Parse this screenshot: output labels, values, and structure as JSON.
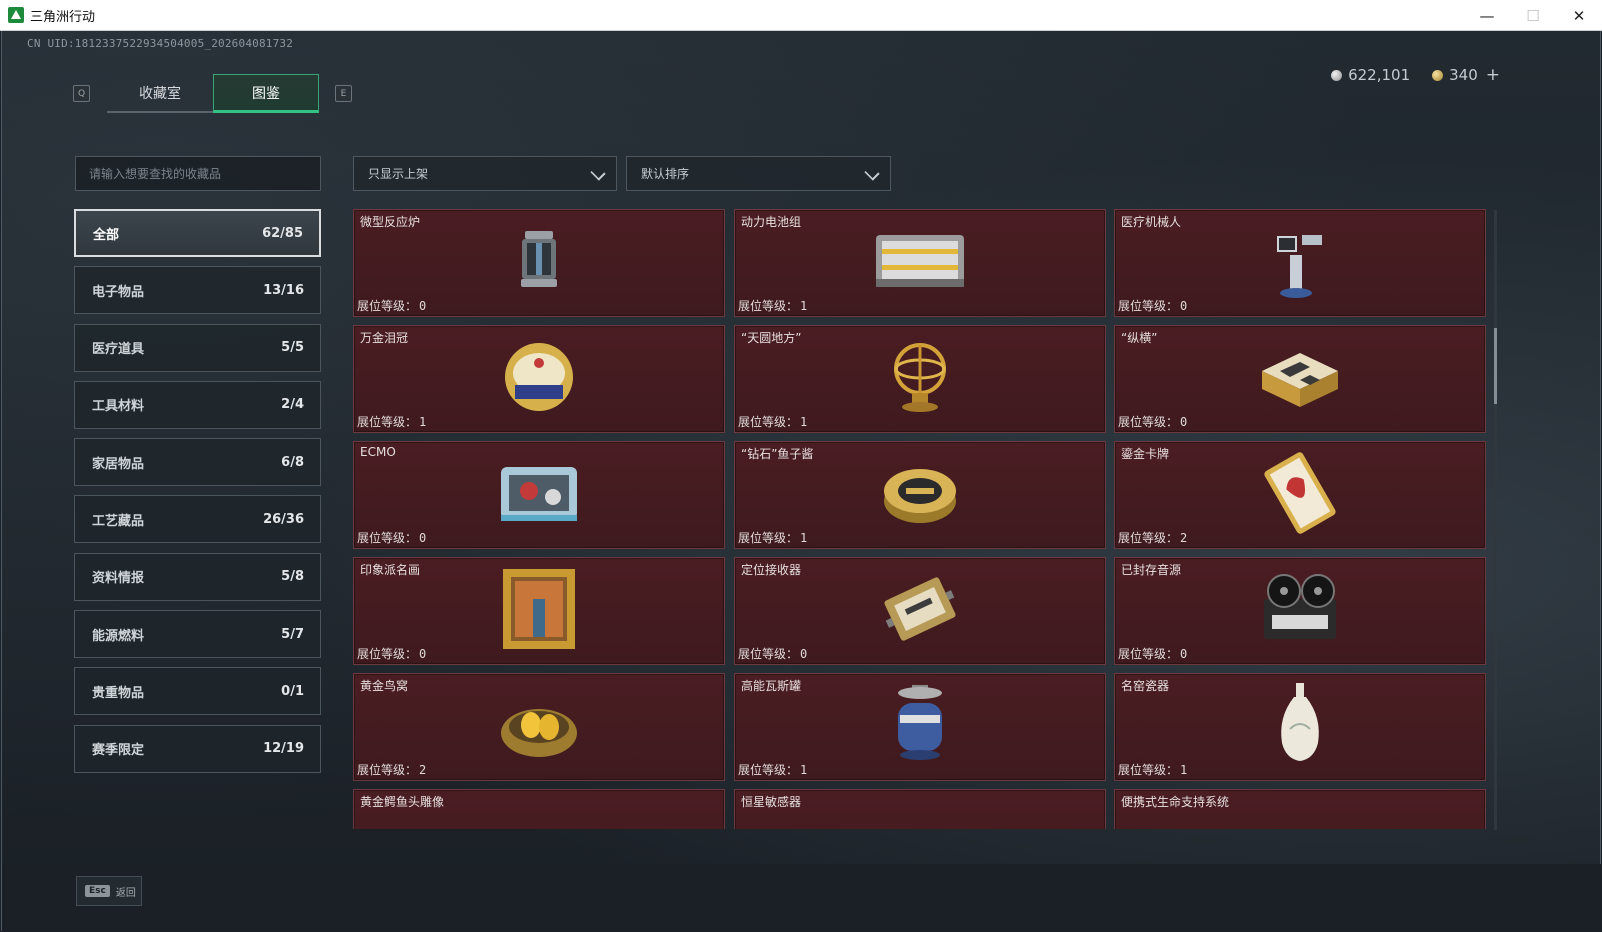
{
  "window": {
    "title": "三角洲行动",
    "controls": {
      "minimize": "—",
      "maximize": "☐",
      "close": "✕"
    }
  },
  "uid": "CN UID:1812337522934504005_202604081732",
  "currency": [
    {
      "icon": "silver-coin-icon",
      "value": "622,101"
    },
    {
      "icon": "gold-coin-icon",
      "value": "340"
    }
  ],
  "currency_add": "+",
  "key_hints": {
    "left": "Q",
    "right": "E"
  },
  "tabs": [
    {
      "label": "收藏室",
      "active": false
    },
    {
      "label": "图鉴",
      "active": true
    }
  ],
  "search": {
    "placeholder": "请输入想要查找的收藏品",
    "value": ""
  },
  "filters": {
    "listed_only": "只显示上架",
    "sort": "默认排序"
  },
  "categories": [
    {
      "label": "全部",
      "count": "62/85",
      "active": true
    },
    {
      "label": "电子物品",
      "count": "13/16",
      "active": false
    },
    {
      "label": "医疗道具",
      "count": "5/5",
      "active": false
    },
    {
      "label": "工具材料",
      "count": "2/4",
      "active": false
    },
    {
      "label": "家居物品",
      "count": "6/8",
      "active": false
    },
    {
      "label": "工艺藏品",
      "count": "26/36",
      "active": false
    },
    {
      "label": "资料情报",
      "count": "5/8",
      "active": false
    },
    {
      "label": "能源燃料",
      "count": "5/7",
      "active": false
    },
    {
      "label": "贵重物品",
      "count": "0/1",
      "active": false
    },
    {
      "label": "赛季限定",
      "count": "12/19",
      "active": false
    }
  ],
  "level_label": "展位等级：",
  "items": [
    {
      "name": "微型反应炉",
      "level": "0",
      "icon": "reactor-icon"
    },
    {
      "name": "动力电池组",
      "level": "1",
      "icon": "battery-pack-icon"
    },
    {
      "name": "医疗机械人",
      "level": "0",
      "icon": "medical-robot-icon"
    },
    {
      "name": "万金泪冠",
      "level": "1",
      "icon": "jeweled-egg-icon"
    },
    {
      "name": "“天圆地方”",
      "level": "1",
      "icon": "armillary-sphere-icon"
    },
    {
      "name": "“纵横”",
      "level": "0",
      "icon": "chess-box-icon"
    },
    {
      "name": "ECMO",
      "level": "0",
      "icon": "ecmo-machine-icon"
    },
    {
      "name": "“钻石”鱼子酱",
      "level": "1",
      "icon": "caviar-tin-icon"
    },
    {
      "name": "鎏金卡牌",
      "level": "2",
      "icon": "gilded-card-icon"
    },
    {
      "name": "印象派名画",
      "level": "0",
      "icon": "framed-painting-icon"
    },
    {
      "name": "定位接收器",
      "level": "0",
      "icon": "gps-receiver-icon"
    },
    {
      "name": "已封存音源",
      "level": "0",
      "icon": "reel-recorder-icon"
    },
    {
      "name": "黄金鸟窝",
      "level": "2",
      "icon": "golden-nest-icon"
    },
    {
      "name": "高能瓦斯罐",
      "level": "1",
      "icon": "gas-canister-icon"
    },
    {
      "name": "名窑瓷器",
      "level": "1",
      "icon": "porcelain-vase-icon"
    },
    {
      "name": "黄金鳄鱼头雕像",
      "level": "",
      "icon": "gold-croc-statue-icon"
    },
    {
      "name": "恒星敏感器",
      "level": "",
      "icon": "star-sensor-icon"
    },
    {
      "name": "便携式生命支持系统",
      "level": "",
      "icon": "life-support-icon"
    }
  ],
  "back": {
    "key": "Esc",
    "label": "返回"
  },
  "colors": {
    "accent": "#33c283",
    "card_bg": "#4a1d22"
  }
}
